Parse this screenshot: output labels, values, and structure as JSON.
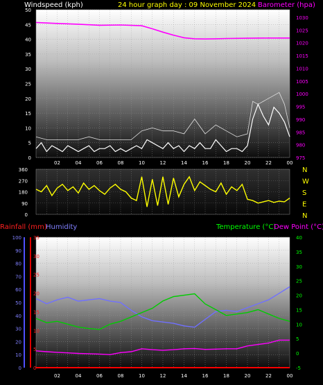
{
  "chart_data": [
    {
      "type": "line",
      "title": "24 hour graph day : 09 November 2024",
      "ylabel": "Windspeed (kph)",
      "y2label": "Barometer (hpa)",
      "ylim": [
        0,
        50
      ],
      "y2lim": [
        975,
        1033
      ],
      "yticks": [
        "0",
        "5",
        "10",
        "15",
        "20",
        "25",
        "30",
        "35",
        "40",
        "45",
        "50"
      ],
      "y2ticks": [
        "975",
        "980",
        "985",
        "990",
        "995",
        "1000",
        "1005",
        "1010",
        "1015",
        "1020",
        "1025",
        "1030"
      ],
      "xticks": [
        "02",
        "04",
        "06",
        "08",
        "10",
        "12",
        "14",
        "16",
        "18",
        "20",
        "22",
        "00"
      ],
      "grid": true,
      "series": [
        {
          "name": "Windspeed (kph)",
          "color": "#ffffff",
          "x": [
            0,
            0.5,
            1,
            1.5,
            2,
            2.5,
            3,
            3.5,
            4,
            4.5,
            5,
            5.5,
            6,
            6.5,
            7,
            7.5,
            8,
            8.5,
            9,
            9.5,
            10,
            10.5,
            11,
            11.5,
            12,
            12.5,
            13,
            13.5,
            14,
            14.5,
            15,
            15.5,
            16,
            16.5,
            17,
            17.5,
            18,
            18.5,
            19,
            19.5,
            20,
            20.5,
            21,
            21.5,
            22,
            22.5,
            23,
            23.5,
            24
          ],
          "values": [
            3,
            5,
            2,
            4,
            3,
            2,
            4,
            3,
            2,
            3,
            4,
            2,
            3,
            3,
            4,
            2,
            3,
            2,
            3,
            4,
            3,
            6,
            5,
            4,
            3,
            5,
            3,
            4,
            2,
            4,
            3,
            5,
            3,
            3,
            6,
            4,
            2,
            3,
            3,
            2,
            4,
            13,
            18,
            14,
            11,
            17,
            15,
            12,
            7
          ]
        },
        {
          "name": "Gust",
          "color": "#e0e0e0",
          "x": [
            0,
            1,
            2,
            3,
            4,
            5,
            6,
            7,
            8,
            9,
            10,
            11,
            12,
            13,
            14,
            15,
            16,
            17,
            18,
            19,
            20,
            20.5,
            21,
            22,
            23,
            23.5,
            24
          ],
          "values": [
            7,
            6,
            6,
            6,
            6,
            7,
            6,
            6,
            6,
            6,
            9,
            10,
            9,
            9,
            8,
            13,
            8,
            11,
            9,
            7,
            8,
            19,
            18,
            20,
            22,
            18,
            10
          ]
        },
        {
          "name": "Barometer (hpa)",
          "color": "#ff00ff",
          "axis": "y2",
          "x": [
            0,
            2,
            4,
            6,
            8,
            10,
            11,
            12,
            13,
            14,
            15,
            16,
            17,
            18,
            20,
            22,
            24
          ],
          "values": [
            1028,
            1027.6,
            1027.3,
            1026.9,
            1027,
            1026.7,
            1025.5,
            1024.2,
            1023,
            1022,
            1021.6,
            1021.5,
            1021.6,
            1021.7,
            1021.8,
            1021.9,
            1021.9
          ]
        }
      ]
    },
    {
      "type": "line",
      "title": "",
      "ylim": [
        0,
        360
      ],
      "yticks": [
        "0",
        "90",
        "180",
        "270",
        "360"
      ],
      "xticks": [],
      "right_labels": [
        "N",
        "W",
        "S",
        "E",
        "N"
      ],
      "grid": true,
      "series": [
        {
          "name": "Wind direction",
          "color": "#ffff00",
          "x": [
            0,
            0.5,
            1,
            1.5,
            2,
            2.5,
            3,
            3.5,
            4,
            4.5,
            5,
            5.5,
            6,
            6.5,
            7,
            7.5,
            8,
            8.5,
            9,
            9.5,
            10,
            10.5,
            11,
            11.5,
            12,
            12.5,
            13,
            13.5,
            14,
            14.5,
            15,
            15.5,
            16,
            16.5,
            17,
            17.5,
            18,
            18.5,
            19,
            19.5,
            20,
            20.5,
            21,
            21.5,
            22,
            22.5,
            23,
            23.5,
            24
          ],
          "values": [
            200,
            180,
            230,
            150,
            210,
            240,
            190,
            220,
            170,
            250,
            200,
            230,
            190,
            160,
            210,
            240,
            200,
            180,
            130,
            110,
            300,
            60,
            280,
            70,
            300,
            80,
            290,
            140,
            240,
            300,
            190,
            260,
            230,
            200,
            180,
            250,
            160,
            220,
            190,
            240,
            120,
            110,
            90,
            100,
            110,
            95,
            105,
            100,
            130
          ]
        }
      ]
    },
    {
      "type": "line",
      "title": "",
      "ylabel": "Rainfall (mm)",
      "ylabel2": "Humidity",
      "y2label": "Temperature (°C)",
      "y2label2": "Dew Point (°C)",
      "ylim_humidity": [
        0,
        100
      ],
      "ylim_rain": [
        0,
        35
      ],
      "y2lim": [
        -5,
        40
      ],
      "yticks_humidity": [
        "0",
        "10",
        "20",
        "30",
        "40",
        "50",
        "60",
        "70",
        "80",
        "90",
        "100"
      ],
      "yticks_rain": [
        "0",
        "5",
        "10",
        "15",
        "20",
        "25",
        "30",
        "35"
      ],
      "y2ticks": [
        "-5",
        "0",
        "5",
        "10",
        "15",
        "20",
        "25",
        "30",
        "35",
        "40"
      ],
      "xticks": [
        "02",
        "04",
        "06",
        "08",
        "10",
        "12",
        "14",
        "16",
        "18",
        "20",
        "22",
        "00"
      ],
      "grid": true,
      "series": [
        {
          "name": "Humidity",
          "color": "#7070ff",
          "axis": "humidity",
          "x": [
            0,
            1,
            2,
            3,
            4,
            5,
            6,
            7,
            8,
            9,
            10,
            11,
            12,
            13,
            14,
            15,
            16,
            17,
            18,
            19,
            20,
            21,
            22,
            23,
            24
          ],
          "values": [
            53,
            49,
            52,
            54,
            51,
            52,
            53,
            51,
            50,
            44,
            39,
            36,
            35,
            34,
            32,
            31,
            37,
            43,
            44,
            43,
            46,
            49,
            52,
            57,
            62
          ]
        },
        {
          "name": "Temperature (°C)",
          "color": "#00cc00",
          "axis": "y2",
          "x": [
            0,
            1,
            2,
            3,
            4,
            5,
            6,
            7,
            8,
            9,
            10,
            11,
            12,
            13,
            14,
            15,
            16,
            17,
            18,
            19,
            20,
            21,
            22,
            23,
            24
          ],
          "values": [
            12,
            10.5,
            11,
            10,
            9,
            8.5,
            8.2,
            10,
            11,
            12.5,
            14,
            15.5,
            18,
            19.5,
            20,
            20.5,
            17,
            15,
            13,
            13.5,
            14,
            15,
            13.5,
            12,
            11
          ]
        },
        {
          "name": "Dew Point (°C)",
          "color": "#ff00ff",
          "axis": "y2",
          "x": [
            0,
            1,
            2,
            3,
            4,
            5,
            6,
            7,
            8,
            9,
            10,
            11,
            12,
            13,
            14,
            15,
            16,
            17,
            18,
            19,
            20,
            21,
            22,
            23,
            24
          ],
          "values": [
            0.8,
            0.5,
            0.3,
            0.1,
            -0.1,
            -0.2,
            -0.3,
            -0.5,
            0.2,
            0.5,
            1.5,
            1.2,
            1,
            1.2,
            1.5,
            1.6,
            1.3,
            1.4,
            1.5,
            1.5,
            2.5,
            3,
            3.5,
            4.5,
            4.5
          ]
        },
        {
          "name": "Rainfall (mm)",
          "color": "#ff0000",
          "axis": "rain",
          "x": [
            0,
            24
          ],
          "values": [
            0,
            0
          ]
        }
      ]
    }
  ]
}
